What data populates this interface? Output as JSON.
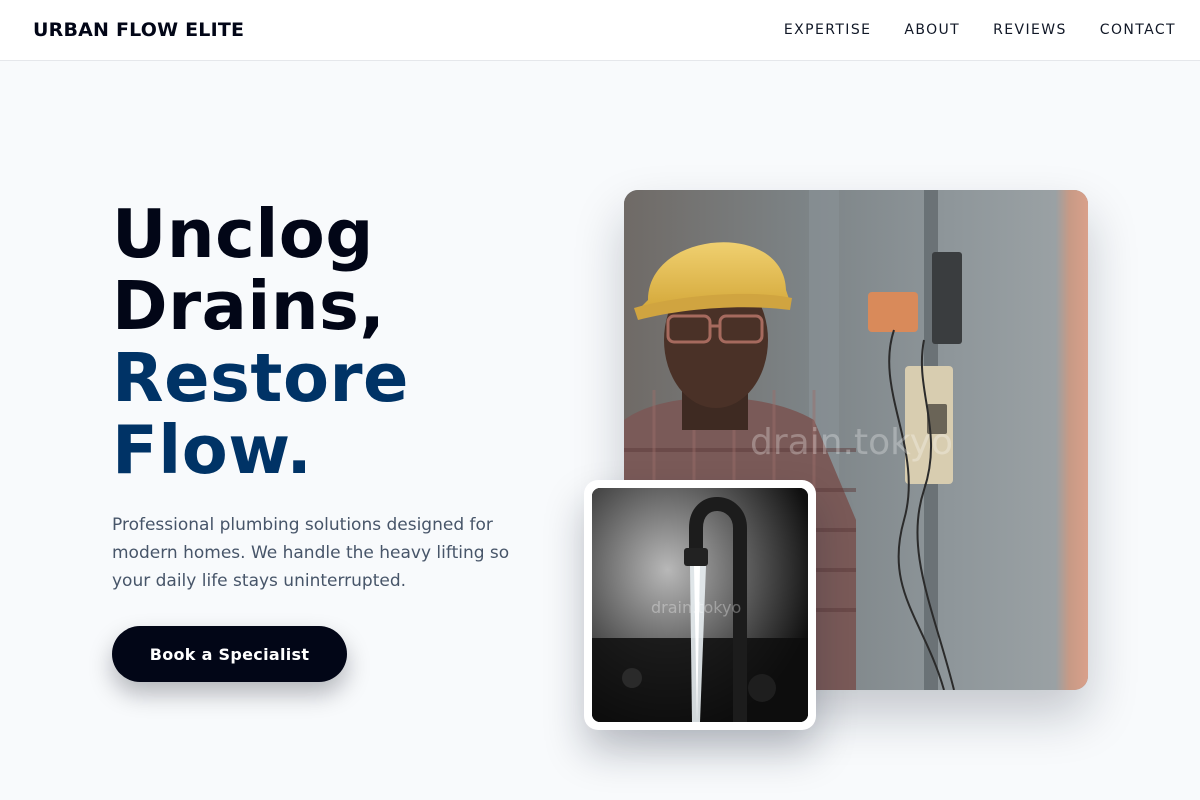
{
  "header": {
    "brand": "URBAN FLOW ELITE",
    "nav": [
      "EXPERTISE",
      "ABOUT",
      "REVIEWS",
      "CONTACT"
    ]
  },
  "hero": {
    "title_lines": [
      "Unclog",
      "Drains,",
      "Restore",
      "Flow."
    ],
    "subtitle": "Professional plumbing solutions designed for modern homes. We handle the heavy lifting so your daily life stays uninterrupted.",
    "cta_label": "Book a Specialist"
  },
  "images": {
    "main_watermark": "drain.tokyo",
    "small_watermark": "drain.tokyo"
  },
  "colors": {
    "accent": "#003366",
    "dark": "#020617",
    "background": "#f8fafc",
    "muted_text": "#475569"
  }
}
